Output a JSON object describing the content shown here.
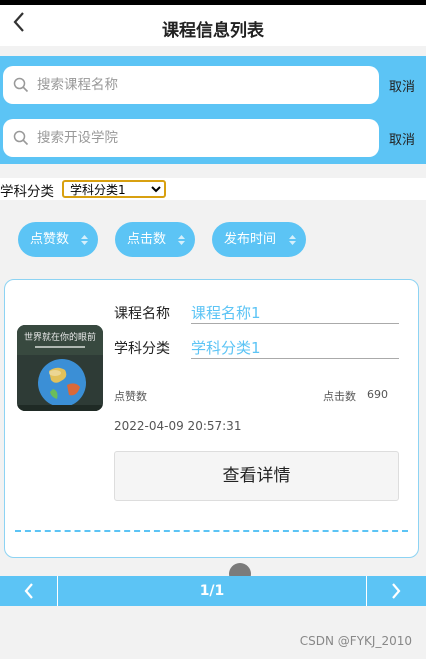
{
  "nav": {
    "back_icon": "chevron-left-icon",
    "title": "课程信息列表"
  },
  "search": [
    {
      "placeholder": "搜索课程名称",
      "cancel": "取消"
    },
    {
      "placeholder": "搜索开设学院",
      "cancel": "取消"
    }
  ],
  "filter": {
    "label": "学科分类",
    "selected": "学科分类1",
    "options": [
      "学科分类1"
    ]
  },
  "sort_buttons": [
    "点赞数",
    "点击数",
    "发布时间"
  ],
  "colors": {
    "accent": "#5cc4f5",
    "card_border": "#8dd3f3"
  },
  "course": {
    "name_label": "课程名称",
    "name_value": "课程名称1",
    "category_label": "学科分类",
    "category_value": "学科分类1",
    "likes_label": "点赞数",
    "clicks_label": "点击数",
    "clicks_value": "690",
    "date": "2022-04-09 20:57:31",
    "detail_button": "查看详情",
    "thumb_caption": "世界就在你的眼前"
  },
  "pager": {
    "prev_icon": "chevron-left-icon",
    "page": "1/1",
    "next_icon": "chevron-right-icon"
  },
  "watermark": "CSDN @FYKJ_2010"
}
